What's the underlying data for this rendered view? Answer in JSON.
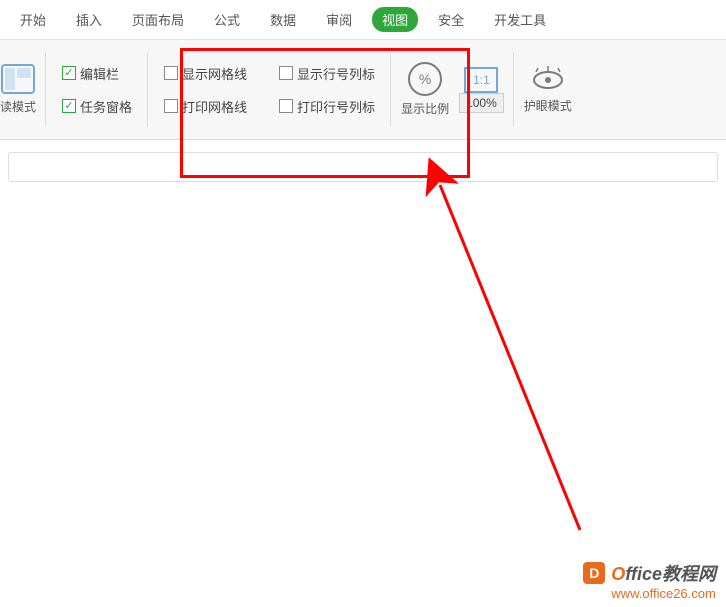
{
  "tabs": {
    "start": "开始",
    "insert": "插入",
    "page_layout": "页面布局",
    "formula": "公式",
    "data": "数据",
    "review": "审阅",
    "view": "视图",
    "security": "安全",
    "dev_tools": "开发工具"
  },
  "ribbon": {
    "reading_mode": "读模式",
    "formula_bar": "编辑栏",
    "task_pane": "任务窗格",
    "show_gridlines": "显示网格线",
    "show_headings": "显示行号列标",
    "print_gridlines": "打印网格线",
    "print_headings": "打印行号列标",
    "zoom_ratio": "显示比例",
    "zoom_100": "100%",
    "eye_mode": "护眼模式",
    "ratio_icon": "1:1"
  },
  "checked": {
    "formula_bar": true,
    "task_pane": true,
    "show_gridlines": false,
    "show_headings": false,
    "print_gridlines": false,
    "print_headings": false
  },
  "watermark": {
    "brand_o": "O",
    "brand_rest": "ffice教程网",
    "url": "www.office26.com",
    "logo_letter": "D"
  }
}
